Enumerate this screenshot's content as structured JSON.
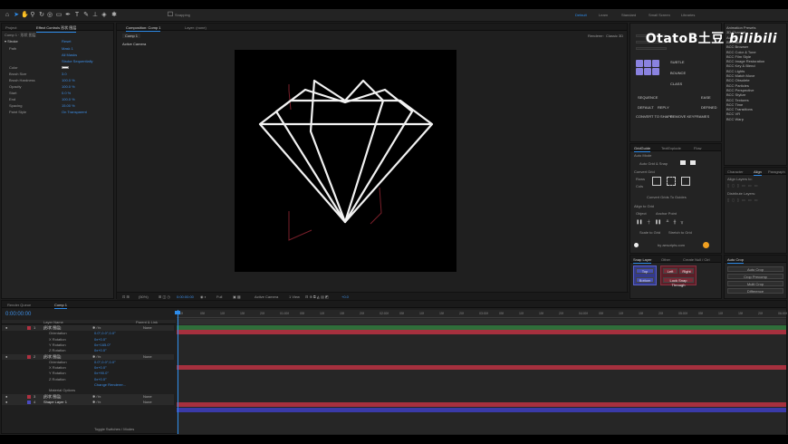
{
  "watermark": {
    "channel": "OtatoB土豆",
    "brand": "bilibili"
  },
  "workspaces": [
    "Default",
    "Learn",
    "Standard",
    "Small Screen",
    "Libraries"
  ],
  "toolbar": {
    "snapping": "Snapping"
  },
  "project_panel": {
    "tabs": [
      "Project",
      "Effect Controls 形状 图层"
    ],
    "breadcrumb": "Comp 1 · 形状 图层",
    "effect_name": "Stroke",
    "header_right": "Reset",
    "rows": [
      {
        "label": "Path",
        "value": "Mask 1"
      },
      {
        "label": "",
        "value": "All Masks"
      },
      {
        "label": "",
        "value": "Stroke Sequentially"
      },
      {
        "label": "Color",
        "value": ""
      },
      {
        "label": "Brush Size",
        "value": "3.0"
      },
      {
        "label": "Brush Hardness",
        "value": "100.0 %"
      },
      {
        "label": "Opacity",
        "value": "100.0 %"
      },
      {
        "label": "Start",
        "value": "0.0 %"
      },
      {
        "label": "End",
        "value": "100.0 %"
      },
      {
        "label": "Spacing",
        "value": "15.00 %"
      },
      {
        "label": "Paint Style",
        "value": "On Transparent"
      }
    ]
  },
  "composition": {
    "tabs": [
      "Composition: Comp 1",
      "Layer: (none)"
    ],
    "sub_tab": "Comp 1",
    "viewer_label": "Active Camera",
    "right_labels": [
      "Renderer:",
      "Classic 3D"
    ],
    "footer": [
      "(50%)",
      "0:00:00:00",
      "Full",
      "Active Camera",
      "1 View",
      "+0.0"
    ]
  },
  "right_panel": {
    "effects_list": [
      "Animation Presets",
      "3D Channel",
      "Audio",
      "BCC Blur",
      "BCC Browser",
      "BCC Color & Tone",
      "BCC Film Style",
      "BCC Image Restoration",
      "BCC Key & Blend",
      "BCC Lights",
      "BCC Match Move",
      "BCC Obsolete",
      "BCC Particles",
      "BCC Perspective",
      "BCC Stylize",
      "BCC Textures",
      "BCC Time",
      "BCC Transitions",
      "BCC VR",
      "BCC Warp"
    ],
    "flow_labels": [
      "SUBTLE",
      "BOUNCE",
      "CLASS",
      "SEQUENCE",
      "DEFAULT",
      "REPLY",
      "CONVERT TO SHAPE",
      "REMOVE KEYFRAMES",
      "EASE",
      "DEFINED"
    ],
    "grid_tabs": [
      "GridGuide",
      "TextExplode",
      "Flow"
    ],
    "grid_labels": [
      "Auto Mode",
      "Auto Grid & Snap",
      "Convert Grid",
      "Rows",
      "Cols",
      "Convert Grids To Guides",
      "Align to Grid",
      "Object",
      "Anchor Point",
      "Scale to Grid",
      "Stretch to Grid",
      "by aescripts.com"
    ],
    "char_tabs": [
      "Character",
      "Align",
      "Paragraph"
    ],
    "align_labels": [
      "Align Layers to:",
      "Distribute Layers:"
    ],
    "snap_tabs": [
      "Snap Layer",
      "Other",
      "Create Null / Ctrl"
    ],
    "snap_buttons": [
      "Top",
      "Bottom",
      "Left",
      "Right",
      "Lock",
      "Snap Through"
    ],
    "auto_crop": {
      "title": "Auto Crop",
      "buttons": [
        "Auto Crop",
        "Crop Precomp",
        "Multi Crop",
        "Difference"
      ]
    }
  },
  "timeline": {
    "tabs": [
      "Render Queue",
      "Comp 1"
    ],
    "timecode": "0:00:00:00",
    "columns": [
      "Layer Name",
      "Parent & Link"
    ],
    "footer": "Toggle Switches / Modes",
    "rulers": [
      "0f",
      "05f",
      "10f",
      "15f",
      "20f",
      "01:00f",
      "05f",
      "10f",
      "15f",
      "20f",
      "02:00f",
      "05f",
      "10f",
      "15f",
      "20f",
      "03:00f",
      "05f",
      "10f",
      "15f",
      "20f",
      "04:00f",
      "05f",
      "10f",
      "15f",
      "20f",
      "05:00f",
      "05f",
      "10f",
      "15f",
      "20f",
      "06:00f"
    ],
    "layers": [
      {
        "num": "1",
        "name": "[形状 图层]",
        "parent": "None",
        "color": "#b03040"
      },
      {
        "sub": "Orientation",
        "value": "0.0°,0.0°,0.0°"
      },
      {
        "sub": "X Rotation",
        "value": "0x+0.0°"
      },
      {
        "sub": "Y Rotation",
        "value": "0x+165.0°"
      },
      {
        "sub": "Z Rotation",
        "value": "0x+0.0°"
      },
      {
        "num": "2",
        "name": "[形状 图层]",
        "parent": "None",
        "color": "#b03040"
      },
      {
        "sub": "Orientation",
        "value": "0.0°,0.0°,0.0°"
      },
      {
        "sub": "X Rotation",
        "value": "0x+0.0°"
      },
      {
        "sub": "Y Rotation",
        "value": "0x+90.0°"
      },
      {
        "sub": "Z Rotation",
        "value": "0x+0.0°"
      },
      {
        "sub": "",
        "value": "Change Renderer..."
      },
      {
        "sub": "Material Options",
        "value": ""
      },
      {
        "num": "3",
        "name": "[形状 图层]",
        "parent": "None",
        "color": "#b03040"
      },
      {
        "num": "4",
        "name": "Shape Layer 1",
        "parent": "None",
        "color": "#4a4ac0"
      }
    ]
  },
  "colors": {
    "accent": "#2d8ceb",
    "layer_red": "#a6303e",
    "layer_blue": "#3a3aa8",
    "layer_green": "#2f6e3a"
  }
}
